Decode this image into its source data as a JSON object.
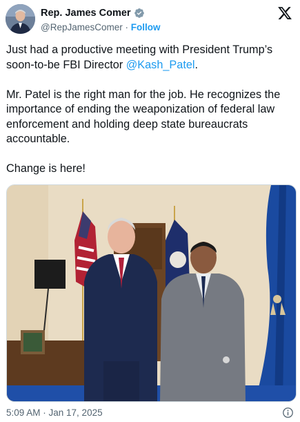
{
  "author": {
    "name": "Rep. James Comer",
    "handle": "@RepJamesComer",
    "separator": " · ",
    "follow_label": "Follow",
    "verified": true
  },
  "tweet": {
    "line1_before": "Just had a productive meeting with President Trump’s soon-to-be FBI Director ",
    "mention": "@Kash_Patel",
    "line1_after": ".",
    "paragraph2": "Mr. Patel is the right man for the job. He recognizes the importance of ending the weaponization of federal law enforcement and holding deep state bureaucrats accountable.",
    "paragraph3": "Change is here!"
  },
  "media": {
    "type": "photo"
  },
  "footer": {
    "timestamp": "5:09 AM · Jan 17, 2025"
  },
  "icons": {
    "verified": "verified-badge-icon",
    "platform": "x-logo-icon",
    "info": "info-icon"
  },
  "colors": {
    "link": "#1d9bf0",
    "secondary_text": "#536471",
    "primary_text": "#0f1419"
  }
}
